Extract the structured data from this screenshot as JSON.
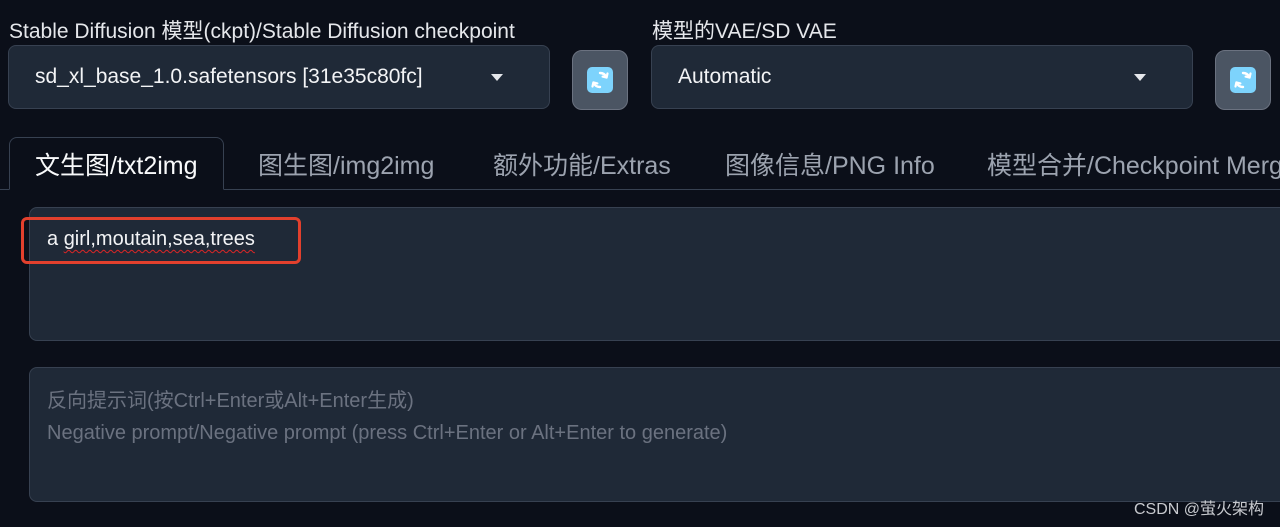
{
  "checkpoint": {
    "label": "Stable Diffusion 模型(ckpt)/Stable Diffusion checkpoint",
    "value": "sd_xl_base_1.0.safetensors [31e35c80fc]",
    "refresh_icon": "refresh-icon"
  },
  "vae": {
    "label": "模型的VAE/SD VAE",
    "value": "Automatic",
    "refresh_icon": "refresh-icon"
  },
  "tabs": [
    {
      "label": "文生图/txt2img",
      "active": true
    },
    {
      "label": "图生图/img2img",
      "active": false
    },
    {
      "label": "额外功能/Extras",
      "active": false
    },
    {
      "label": "图像信息/PNG Info",
      "active": false
    },
    {
      "label": "模型合并/Checkpoint Merg",
      "active": false
    }
  ],
  "prompt": {
    "parts": [
      "a ",
      "girl,moutain,sea,trees"
    ],
    "highlight_color": "#e2402d"
  },
  "negative_prompt": {
    "placeholder_line1": "反向提示词(按Ctrl+Enter或Alt+Enter生成)",
    "placeholder_line2": "Negative prompt/Negative prompt (press Ctrl+Enter or Alt+Enter to generate)"
  },
  "watermark": "CSDN @萤火架构",
  "colors": {
    "background": "#0b0f19",
    "panel": "#1f2937",
    "border": "#374151",
    "button": "#4b5563",
    "refresh_icon": "#60a5fa"
  }
}
